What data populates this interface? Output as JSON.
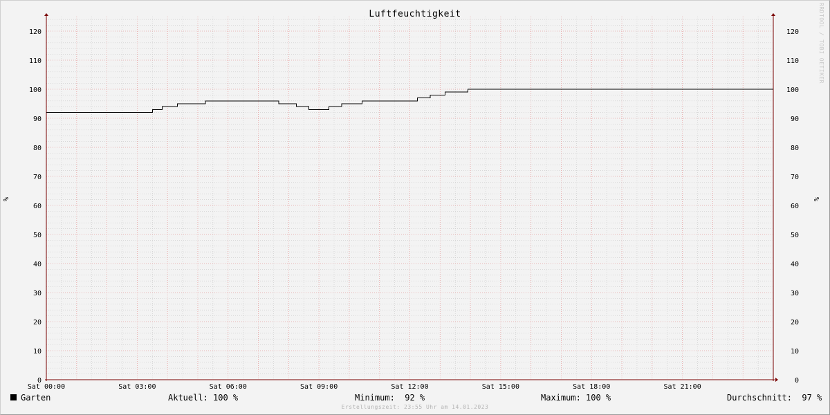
{
  "chart_data": {
    "type": "line",
    "title": "Luftfeuchtigkeit",
    "ylabel": "%",
    "ylim": [
      0,
      125
    ],
    "yticks": [
      0,
      10,
      20,
      30,
      40,
      50,
      60,
      70,
      80,
      90,
      100,
      110,
      120
    ],
    "xlim": [
      0,
      24
    ],
    "xticks": [
      {
        "h": 0,
        "label": "Sat 00:00"
      },
      {
        "h": 3,
        "label": "Sat 03:00"
      },
      {
        "h": 6,
        "label": "Sat 06:00"
      },
      {
        "h": 9,
        "label": "Sat 09:00"
      },
      {
        "h": 12,
        "label": "Sat 12:00"
      },
      {
        "h": 15,
        "label": "Sat 15:00"
      },
      {
        "h": 18,
        "label": "Sat 18:00"
      },
      {
        "h": 21,
        "label": "Sat 21:00"
      }
    ],
    "grid": true,
    "series": [
      {
        "name": "Garten",
        "color": "#000000",
        "step": true,
        "x": [
          0,
          3.5,
          3.83,
          4.33,
          5.25,
          7.67,
          8.25,
          8.67,
          9.33,
          9.75,
          10.42,
          12.25,
          12.67,
          13.17,
          13.92,
          24
        ],
        "y": [
          92,
          93,
          94,
          95,
          96,
          95,
          94,
          93,
          94,
          95,
          96,
          97,
          98,
          99,
          100,
          100
        ]
      }
    ]
  },
  "legend": {
    "series_name": "Garten",
    "aktuell": "Aktuell: 100 %",
    "minimum": "Minimum:  92 %",
    "maximum": "Maximum: 100 %",
    "durchschnitt": "Durchschnitt:  97 %"
  },
  "footer": "Erstellungszeit: 23:55 Uhr am 14.01.2023",
  "watermark": "RRDTOOL / TOBI OETIKER",
  "colors": {
    "background": "#f3f3f3",
    "major_grid": "#e8a0a0",
    "minor_grid": "#c8c8c8",
    "axis": "#7a0000",
    "line": "#000000"
  }
}
